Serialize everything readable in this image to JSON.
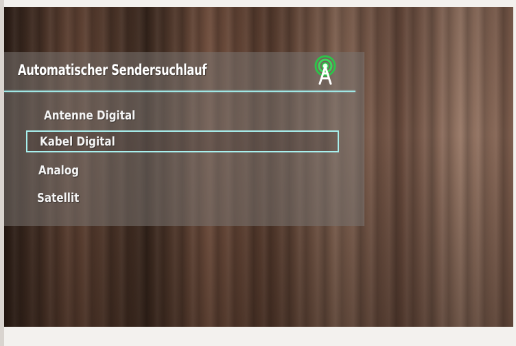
{
  "menu": {
    "title": "Automatischer Sendersuchlauf",
    "header_icon": "antenna-tower-icon",
    "selected_index": 1,
    "items": [
      {
        "label": "Antenne Digital"
      },
      {
        "label": "Kabel Digital"
      },
      {
        "label": "Analog"
      },
      {
        "label": "Satellit"
      }
    ]
  },
  "colors": {
    "accent": "#a8f0ee",
    "icon_green": "#2ec24a",
    "text": "#ffffff"
  }
}
